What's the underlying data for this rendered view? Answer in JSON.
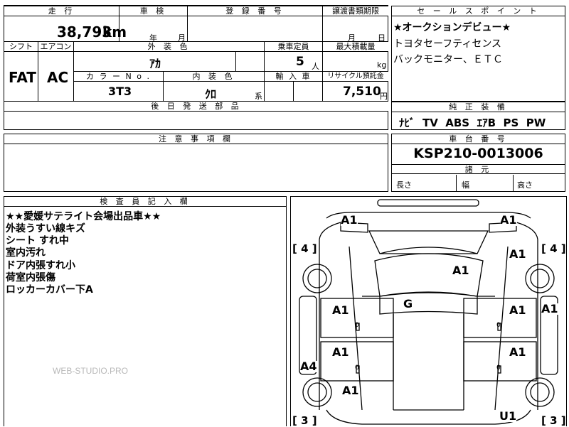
{
  "main": {
    "mileage_label": "走 行",
    "mileage_value": "38,793",
    "mileage_unit": "km",
    "shaken_label": "車 検",
    "shaken_year": "年",
    "shaken_month": "月",
    "reg_label": "登 録 番 号",
    "transfer_label": "譲渡書類期限",
    "transfer_month": "月",
    "transfer_day": "日",
    "shift_label": "シフト",
    "shift_value": "FAT",
    "ac_label": "エアコン",
    "ac_value": "AC",
    "exterior_label": "外 装 色",
    "exterior_value": "ｱｶ",
    "capacity_label": "乗車定員",
    "capacity_value": "5",
    "capacity_unit": "人",
    "maxload_label": "最大積載量",
    "maxload_unit": "kg",
    "color_no_label": "カ ラ ー N o .",
    "color_no_value": "3T3",
    "interior_label": "内 装 色",
    "interior_value": "ｸﾛ",
    "interior_unit": "系",
    "import_label": "輸 入 車",
    "recycle_label": "リサイクル預託金",
    "recycle_value": "7,510",
    "recycle_unit": "円",
    "parts_label": "後 日 発 送 部 品"
  },
  "sales": {
    "label": "セ ー ル ス ポ イ ン ト",
    "lines": [
      "★オークションデビュー★",
      "トヨタセーフティセンス",
      "バックモニター、ＥＴＣ"
    ]
  },
  "equipment": {
    "label": "純 正 装 備",
    "items": [
      "ﾅﾋﾞ",
      "TV",
      "ABS",
      "ｴｱB",
      "PS",
      "PW"
    ]
  },
  "notes": {
    "label": "注 意 事 項 欄"
  },
  "chassis": {
    "label": "車 台 番 号",
    "value": "KSP210-0013006",
    "dims_label": "諸 元",
    "length_label": "長さ",
    "width_label": "幅",
    "height_label": "高さ"
  },
  "inspector": {
    "label": "検 査 員 記 入 欄",
    "lines": [
      "★★愛媛サテライト会場出品車★★",
      "外装うすい線キズ",
      "シート すれ中",
      "室内汚れ",
      "ドア内張すれ小",
      "荷室内張傷",
      "ロッカーカバー下A"
    ],
    "watermark": "WEB-STUDIO.PRO"
  },
  "diagram": {
    "marks": {
      "front_left": "A1",
      "front_right": "A1",
      "left_tire": "4",
      "right_tire": "4",
      "hood_right": "A1",
      "roof": "A1",
      "windshield": "G",
      "fender_right": "A1",
      "door_fl": "A1",
      "door_fr": "A1",
      "door_right_outer": "A1",
      "door_rl": "A1",
      "door_rr": "A1",
      "rocker_left": "A4",
      "rear_left": "A1",
      "rear_bottom_right": "U1",
      "rear_left_tire": "3",
      "rear_right_tire": "3"
    }
  }
}
